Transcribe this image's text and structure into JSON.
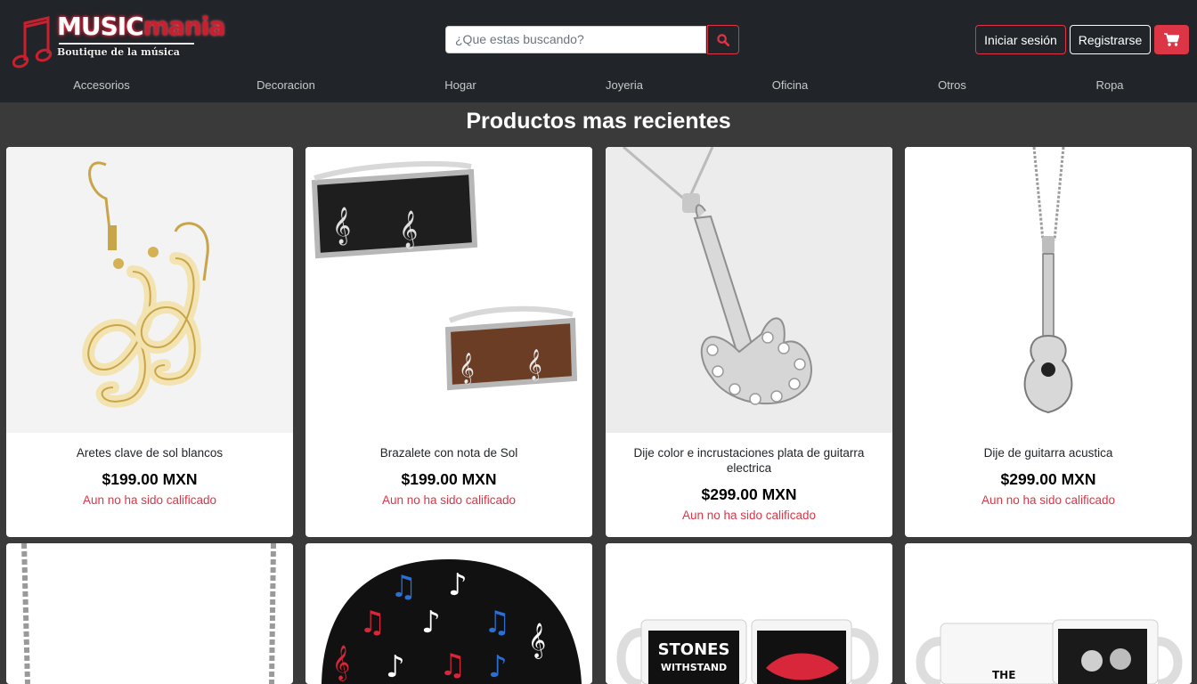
{
  "brand": {
    "word1": "MUSIC",
    "word2": "mania",
    "tagline": "Boutique de la música",
    "accent": "#dc3545"
  },
  "search": {
    "placeholder": "¿Que estas buscando?",
    "icon": "search-icon"
  },
  "auth": {
    "login_label": "Iniciar sesión",
    "register_label": "Registrarse"
  },
  "cart": {
    "icon": "cart-icon"
  },
  "nav": {
    "items": [
      "Accesorios",
      "Decoracion",
      "Hogar",
      "Joyeria",
      "Oficina",
      "Otros",
      "Ropa"
    ]
  },
  "main": {
    "title": "Productos mas recientes",
    "products": [
      {
        "name": "Aretes clave de sol blancos",
        "price": "$199.00 MXN",
        "rating": "Aun no ha sido calificado",
        "image": "treble-clef-earrings"
      },
      {
        "name": "Brazalete con nota de Sol",
        "price": "$199.00 MXN",
        "rating": "Aun no ha sido calificado",
        "image": "treble-clef-bracelets"
      },
      {
        "name": "Dije color e incrustaciones plata de guitarra electrica",
        "price": "$299.00 MXN",
        "rating": "Aun no ha sido calificado",
        "image": "electric-guitar-pendant"
      },
      {
        "name": "Dije de guitarra acustica",
        "price": "$299.00 MXN",
        "rating": "Aun no ha sido calificado",
        "image": "acoustic-guitar-pendant"
      },
      {
        "image": "chain-necklace"
      },
      {
        "image": "music-notes-beanie"
      },
      {
        "image": "rolling-stones-mugs"
      },
      {
        "image": "beatles-mugs"
      }
    ]
  }
}
